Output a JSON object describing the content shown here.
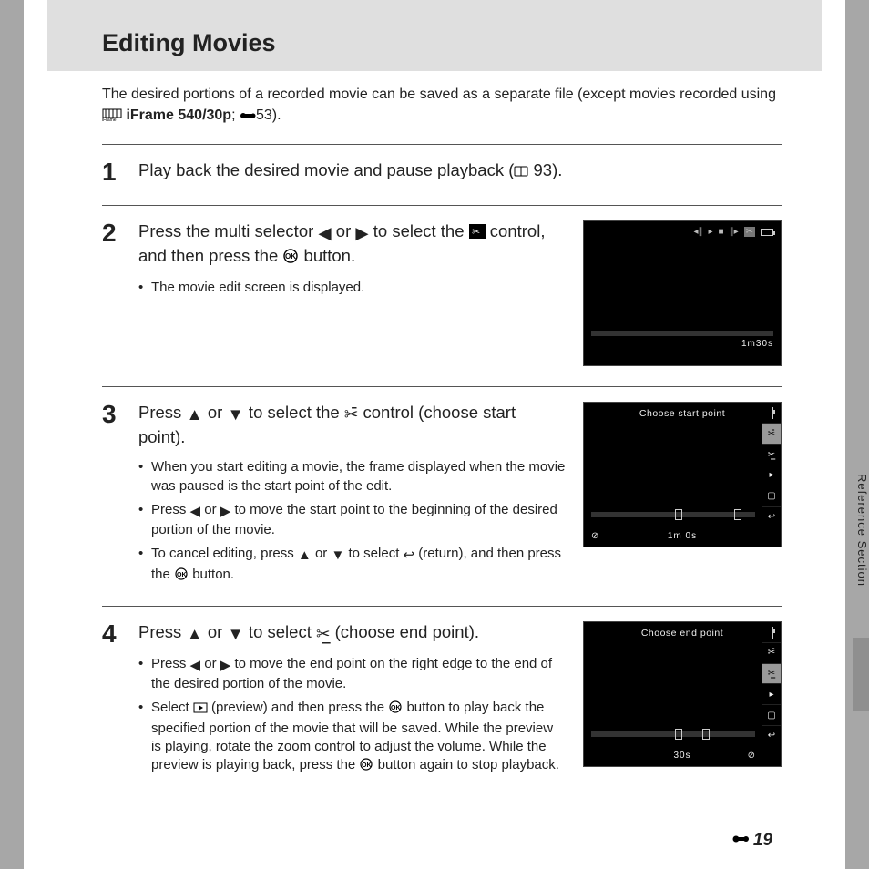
{
  "title": "Editing Movies",
  "intro": {
    "t1": "The desired portions of a recorded movie can be saved as a separate file (except movies recorded using ",
    "iframe_label": "iFrame 540/30p",
    "t2": "; ",
    "ref": "53).",
    "iframe_icon": "iframe-icon",
    "wrench_icon": "wrench-icon"
  },
  "step1": {
    "num": "1",
    "a": "Play back the desired movie and pause playback (",
    "b": " 93)."
  },
  "step2": {
    "num": "2",
    "a": "Press the multi selector ",
    "b": " or ",
    "c": " to select the ",
    "d": " control, and then press the ",
    "e": " button.",
    "sub1": "The movie edit screen is displayed.",
    "lcd_time": "1m30s"
  },
  "step3": {
    "num": "3",
    "a": "Press ",
    "b": " or ",
    "c": " to select the ",
    "d": " control (choose start point).",
    "sub1": "When you start editing a movie, the frame displayed when the movie was paused is the start point of the edit.",
    "sub2a": "Press ",
    "sub2b": " or ",
    "sub2c": " to move the start point to the beginning of the desired portion of the movie.",
    "sub3a": "To cancel editing, press ",
    "sub3b": " or ",
    "sub3c": " to select ",
    "sub3d": " (return), and then press the ",
    "sub3e": " button.",
    "lcd_title": "Choose start point",
    "lcd_time": "1m 0s"
  },
  "step4": {
    "num": "4",
    "a": "Press ",
    "b": " or ",
    "c": " to select ",
    "d": " (choose end point).",
    "sub1a": "Press ",
    "sub1b": " or ",
    "sub1c": " to move the end point on the right edge to the end of the desired portion of the movie.",
    "sub2a": "Select ",
    "sub2b": " (preview) and then press the ",
    "sub2c": " button to play back the specified portion of the movie that will be saved. While the preview is playing, rotate the zoom control to adjust the volume. While the preview is playing back, press the ",
    "sub2d": " button again to stop playback.",
    "lcd_title": "Choose end point",
    "lcd_time": "30s"
  },
  "side_label": "Reference Section",
  "page_number": "19"
}
